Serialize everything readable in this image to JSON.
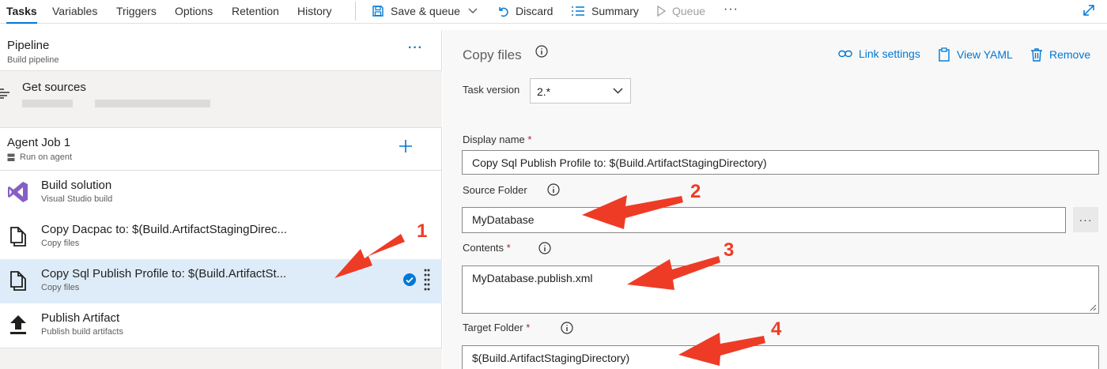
{
  "toolbar": {
    "tabs": [
      "Tasks",
      "Variables",
      "Triggers",
      "Options",
      "Retention",
      "History"
    ],
    "save_queue": "Save & queue",
    "discard": "Discard",
    "summary": "Summary",
    "queue": "Queue",
    "more": "···"
  },
  "pipeline": {
    "title": "Pipeline",
    "subtitle": "Build pipeline",
    "more": "···"
  },
  "get_sources": {
    "title": "Get sources"
  },
  "agent_job": {
    "title": "Agent Job 1",
    "subtitle": "Run on agent"
  },
  "tasks": [
    {
      "title": "Build solution",
      "subtitle": "Visual Studio build",
      "icon": "visual-studio-icon"
    },
    {
      "title": "Copy Dacpac to: $(Build.ArtifactStagingDirec...",
      "subtitle": "Copy files",
      "icon": "copy-files-icon"
    },
    {
      "title": "Copy Sql Publish Profile to: $(Build.ArtifactSt...",
      "subtitle": "Copy files",
      "icon": "copy-files-icon",
      "selected": true
    },
    {
      "title": "Publish Artifact",
      "subtitle": "Publish build artifacts",
      "icon": "upload-icon"
    }
  ],
  "detail": {
    "title": "Copy files",
    "link_settings": "Link settings",
    "view_yaml": "View YAML",
    "remove": "Remove",
    "task_version_label": "Task version",
    "task_version_value": "2.*",
    "display_name_label": "Display name",
    "display_name_value": "Copy Sql Publish Profile to: $(Build.ArtifactStagingDirectory)",
    "source_folder_label": "Source Folder",
    "source_folder_value": "MyDatabase",
    "browse": "···",
    "contents_label": "Contents",
    "contents_value": "MyDatabase.publish.xml",
    "target_folder_label": "Target Folder",
    "target_folder_value": "$(Build.ArtifactStagingDirectory)",
    "required_mark": "*"
  },
  "annotations": {
    "n1": "1",
    "n2": "2",
    "n3": "3",
    "n4": "4"
  },
  "colors": {
    "accent": "#0078d4",
    "selected_row": "#deecf9",
    "annotation": "#ee3b26"
  }
}
